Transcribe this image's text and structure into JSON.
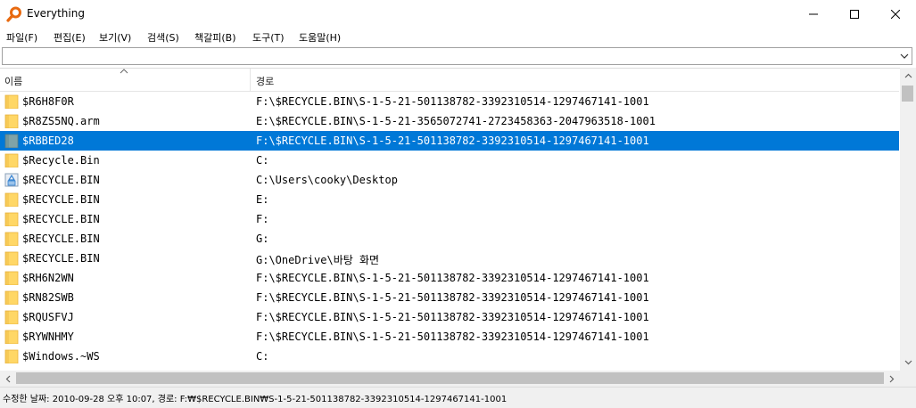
{
  "window": {
    "title": "Everything"
  },
  "menu": [
    "파일(F)",
    "편집(E)",
    "보기(V)",
    "검색(S)",
    "책갈피(B)",
    "도구(T)",
    "도움말(H)"
  ],
  "search": {
    "value": "",
    "placeholder": ""
  },
  "columns": {
    "name": "이름",
    "path": "경로"
  },
  "rows": [
    {
      "name": "$R6H8F0R",
      "path": "F:\\$RECYCLE.BIN\\S-1-5-21-501138782-3392310514-1297467141-1001",
      "icon": "folder-icon",
      "selected": false
    },
    {
      "name": "$R8ZS5NQ.arm",
      "path": "E:\\$RECYCLE.BIN\\S-1-5-21-3565072741-2723458363-2047963518-1001",
      "icon": "folder-icon",
      "selected": false
    },
    {
      "name": "$RBBED28",
      "path": "F:\\$RECYCLE.BIN\\S-1-5-21-501138782-3392310514-1297467141-1001",
      "icon": "folder-icon",
      "selected": true
    },
    {
      "name": "$Recycle.Bin",
      "path": "C:",
      "icon": "folder-icon",
      "selected": false
    },
    {
      "name": "$RECYCLE.BIN",
      "path": "C:\\Users\\cooky\\Desktop",
      "icon": "recycle-bin-icon",
      "selected": false
    },
    {
      "name": "$RECYCLE.BIN",
      "path": "E:",
      "icon": "folder-icon",
      "selected": false
    },
    {
      "name": "$RECYCLE.BIN",
      "path": "F:",
      "icon": "folder-icon",
      "selected": false
    },
    {
      "name": "$RECYCLE.BIN",
      "path": "G:",
      "icon": "folder-icon",
      "selected": false
    },
    {
      "name": "$RECYCLE.BIN",
      "path": "G:\\OneDrive\\바탕 화면",
      "icon": "folder-icon",
      "selected": false
    },
    {
      "name": "$RH6N2WN",
      "path": "F:\\$RECYCLE.BIN\\S-1-5-21-501138782-3392310514-1297467141-1001",
      "icon": "folder-icon",
      "selected": false
    },
    {
      "name": "$RN82SWB",
      "path": "F:\\$RECYCLE.BIN\\S-1-5-21-501138782-3392310514-1297467141-1001",
      "icon": "folder-icon",
      "selected": false
    },
    {
      "name": "$RQUSFVJ",
      "path": "F:\\$RECYCLE.BIN\\S-1-5-21-501138782-3392310514-1297467141-1001",
      "icon": "folder-icon",
      "selected": false
    },
    {
      "name": "$RYWNHMY",
      "path": "F:\\$RECYCLE.BIN\\S-1-5-21-501138782-3392310514-1297467141-1001",
      "icon": "folder-icon",
      "selected": false
    },
    {
      "name": "$Windows.~WS",
      "path": "C:",
      "icon": "folder-icon",
      "selected": false
    }
  ],
  "status": {
    "text": "수정한 날짜: 2010-09-28 오후 10:07, 경로: F:₩$RECYCLE.BIN₩S-1-5-21-501138782-3392310514-1297467141-1001"
  },
  "colors": {
    "selection": "#0078d7",
    "folder": "#ffd766",
    "folder_dark": "#e8b33c",
    "app_icon": "#e86a10"
  }
}
